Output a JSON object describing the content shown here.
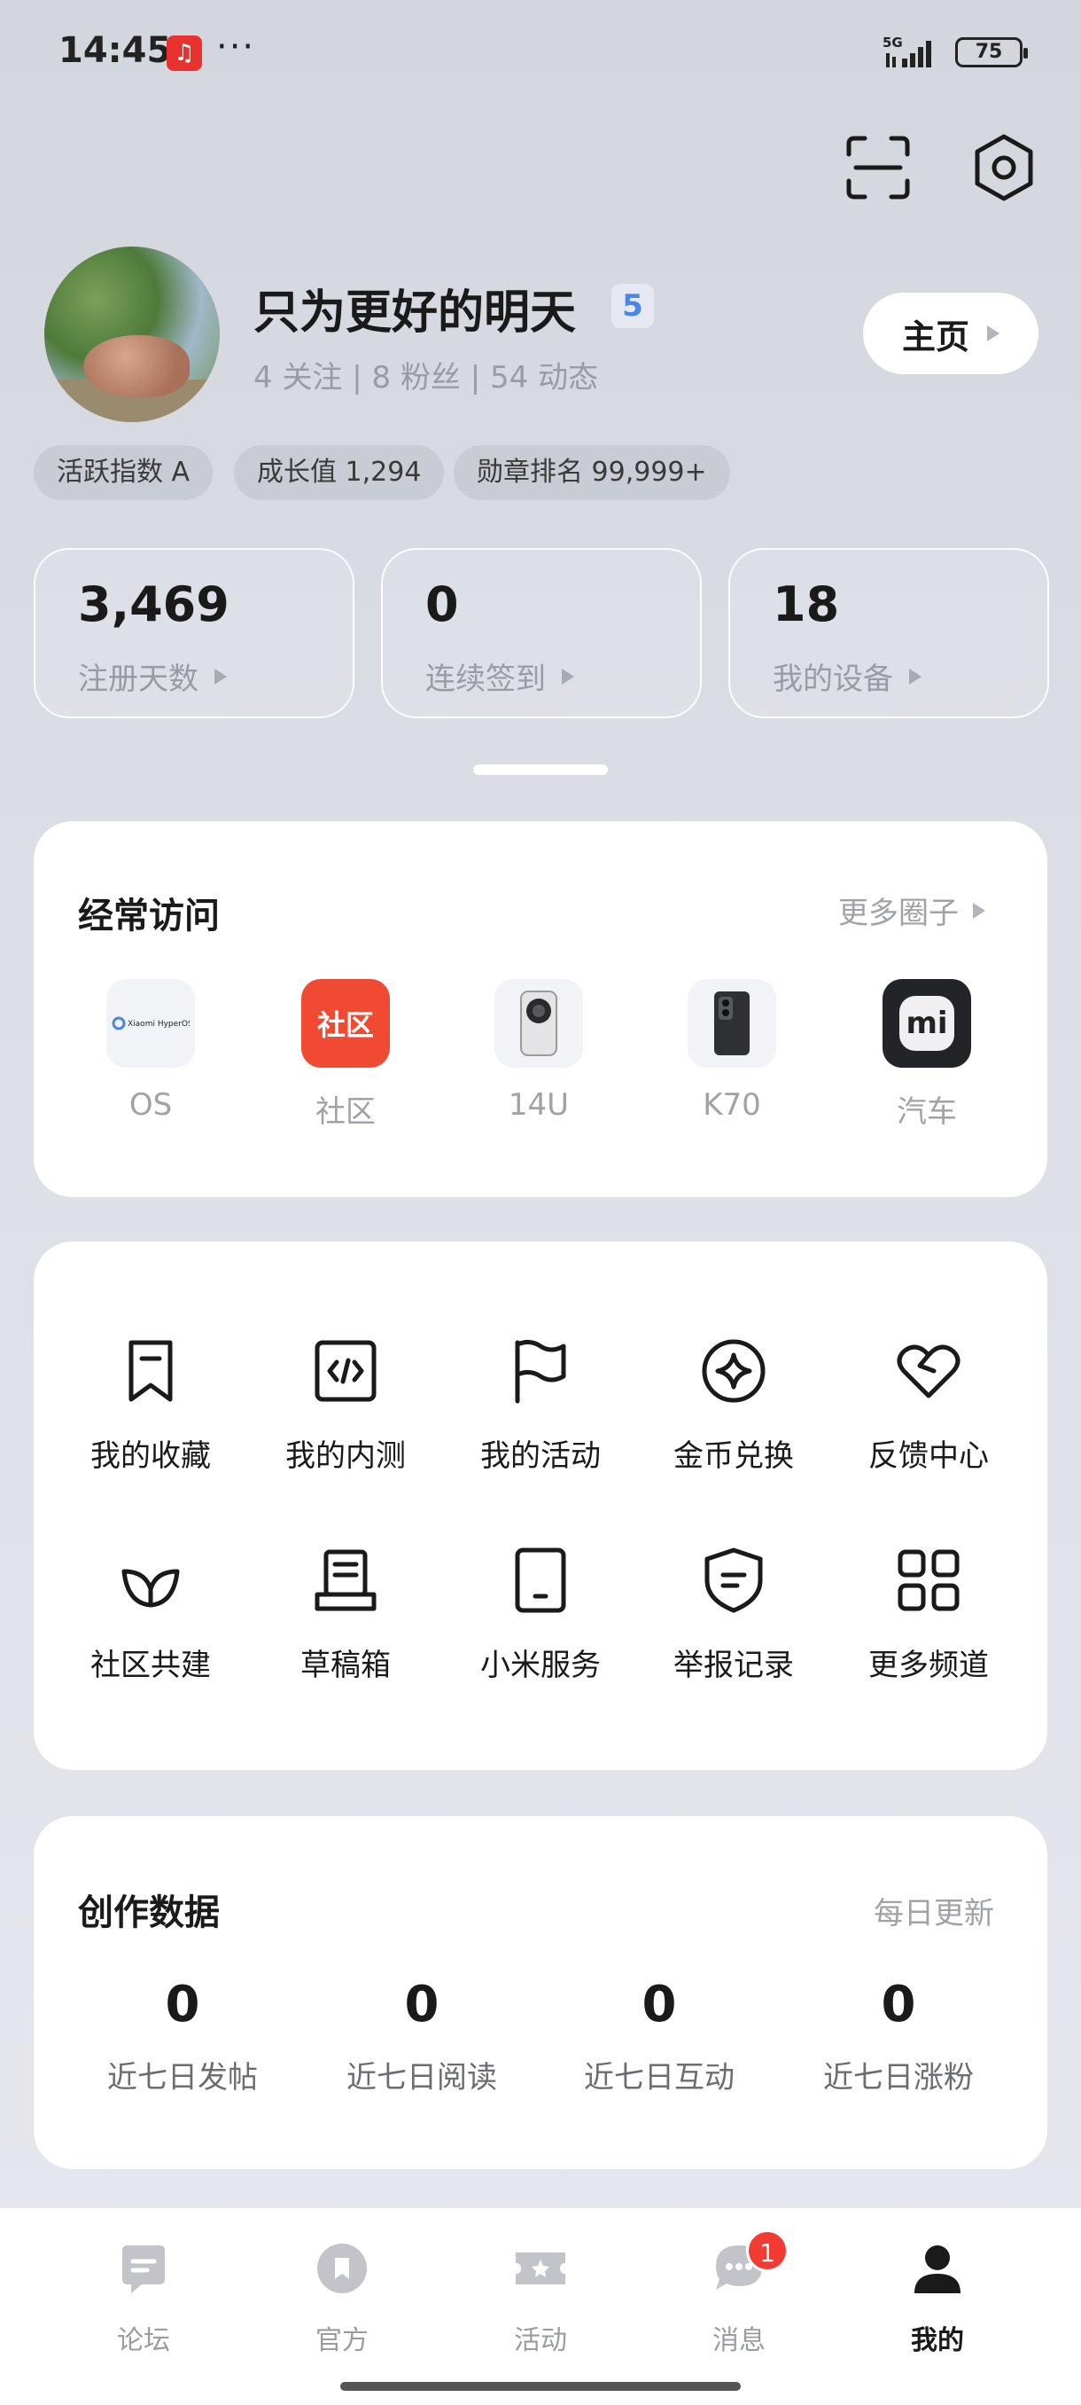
{
  "status_bar": {
    "time": "14:45",
    "app_icon": "netease-music-icon",
    "dots": "···",
    "network": "5G",
    "battery": "75"
  },
  "header": {
    "scan_icon": "scan-icon",
    "settings_icon": "settings-hexagon-icon"
  },
  "profile": {
    "username": "只为更好的明天",
    "level": "5",
    "stats_text": "4 关注 | 8 粉丝 | 54 动态",
    "home_button": "主页",
    "chips": [
      "活跃指数 A",
      "成长值 1,294",
      "勋章排名 99,999+"
    ]
  },
  "stat_cards": [
    {
      "value": "3,469",
      "label": "注册天数"
    },
    {
      "value": "0",
      "label": "连续签到"
    },
    {
      "value": "18",
      "label": "我的设备"
    }
  ],
  "frequent": {
    "title": "经常访问",
    "more_link": "更多圈子",
    "items": [
      {
        "label": "OS",
        "icon": "xiaomi-hyperos-icon",
        "icon_text": "Xiaomi HyperOS"
      },
      {
        "label": "社区",
        "icon": "community-icon",
        "icon_text": "社区"
      },
      {
        "label": "14U",
        "icon": "phone-14u-icon"
      },
      {
        "label": "K70",
        "icon": "phone-k70-icon"
      },
      {
        "label": "汽车",
        "icon": "mi-car-icon",
        "icon_text": "mi"
      }
    ]
  },
  "grid": {
    "row1": [
      {
        "label": "我的收藏",
        "icon": "bookmark-icon"
      },
      {
        "label": "我的内测",
        "icon": "code-icon"
      },
      {
        "label": "我的活动",
        "icon": "flag-icon"
      },
      {
        "label": "金币兑换",
        "icon": "coin-star-icon"
      },
      {
        "label": "反馈中心",
        "icon": "heart-icon"
      }
    ],
    "row2": [
      {
        "label": "社区共建",
        "icon": "leaf-icon"
      },
      {
        "label": "草稿箱",
        "icon": "draft-box-icon"
      },
      {
        "label": "小米服务",
        "icon": "tablet-icon"
      },
      {
        "label": "举报记录",
        "icon": "shield-icon"
      },
      {
        "label": "更多频道",
        "icon": "grid-icon"
      }
    ]
  },
  "creation": {
    "title": "创作数据",
    "subtitle": "每日更新",
    "metrics": [
      {
        "value": "0",
        "label": "近七日发帖"
      },
      {
        "value": "0",
        "label": "近七日阅读"
      },
      {
        "value": "0",
        "label": "近七日互动"
      },
      {
        "value": "0",
        "label": "近七日涨粉"
      }
    ]
  },
  "bottom_nav": {
    "items": [
      {
        "label": "论坛",
        "icon": "forum-icon"
      },
      {
        "label": "官方",
        "icon": "official-icon"
      },
      {
        "label": "活动",
        "icon": "ticket-icon"
      },
      {
        "label": "消息",
        "icon": "message-icon",
        "badge": "1"
      },
      {
        "label": "我的",
        "icon": "person-icon",
        "active": true
      }
    ]
  },
  "colors": {
    "accent_red": "#f13b33",
    "community_red": "#f04a32",
    "level_blue": "#4a86e8"
  }
}
